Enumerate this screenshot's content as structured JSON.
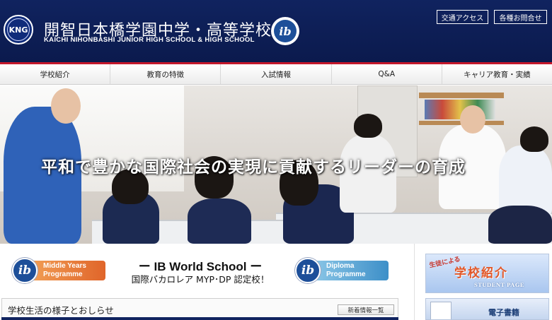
{
  "header": {
    "seal_text": "KNG",
    "school_name_ja": "開智日本橋学園中学・高等学校",
    "school_name_en": "KAICHI NIHONBASHI JUNIOR HIGH SCHOOL & HIGH SCHOOL",
    "ib_logo_text": "ib",
    "access_label": "交通アクセス",
    "contact_label": "各種お問合せ",
    "colors": {
      "header_bg": "#10235f",
      "accent_line": "#c3172b"
    }
  },
  "nav": {
    "items": [
      {
        "label": "学校紹介"
      },
      {
        "label": "教育の特徴"
      },
      {
        "label": "入試情報"
      },
      {
        "label": "Q&A"
      },
      {
        "label": "キャリア教育・実績"
      }
    ]
  },
  "hero": {
    "slogan": "平和で豊かな国際社会の実現に貢献するリーダーの育成"
  },
  "ib_banner": {
    "myp_line1": "Middle Years",
    "myp_line2": "Programme",
    "dp_line1": "Diploma",
    "dp_line2": "Programme",
    "title": "ー IB World School ー",
    "subtitle": "国際バカロレア MYP･DP 認定校！",
    "logo_text": "ib"
  },
  "news": {
    "title": "学校生活の様子とおしらせ",
    "more_label": "新着情報一覧"
  },
  "sidebar": {
    "student_small": "生徒による",
    "student_big": "学校紹介",
    "student_en": "STUDENT PAGE",
    "ebook_title": "電子書籍"
  }
}
